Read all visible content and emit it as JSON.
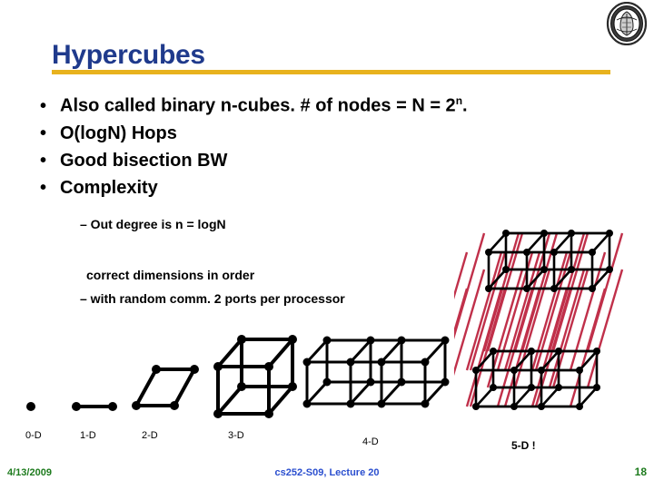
{
  "slide": {
    "title": "Hypercubes",
    "accent_title_color": "#1F3A8C",
    "accent_rule_color": "#E8B21E",
    "edge_color": "#000000",
    "highlight_edge_color": "#C0304A"
  },
  "logo": {
    "name": "uc-berkeley-seal"
  },
  "bullets": [
    {
      "marker": "•",
      "text": "Also called binary n-cubes.   # of nodes = N = 2",
      "sup": "n",
      "tail": "."
    },
    {
      "marker": "•",
      "text": "O(logN) Hops",
      "sup": "",
      "tail": ""
    },
    {
      "marker": "•",
      "text": "Good bisection BW",
      "sup": "",
      "tail": ""
    },
    {
      "marker": "•",
      "text": "Complexity",
      "sup": "",
      "tail": ""
    }
  ],
  "sub_bullets": [
    {
      "text": "– Out degree is n = logN"
    },
    {
      "text": "correct dimensions in order"
    },
    {
      "text": "– with random comm. 2 ports per processor"
    }
  ],
  "figures": {
    "labels": [
      "0-D",
      "1-D",
      "2-D",
      "3-D",
      "4-D",
      "5-D !"
    ]
  },
  "footer": {
    "date": "4/13/2009",
    "center": "cs252-S09, Lecture 20",
    "page": "18",
    "date_color": "#1E7B1E",
    "center_color": "#2B4FCF",
    "page_color": "#1E7B1E"
  }
}
